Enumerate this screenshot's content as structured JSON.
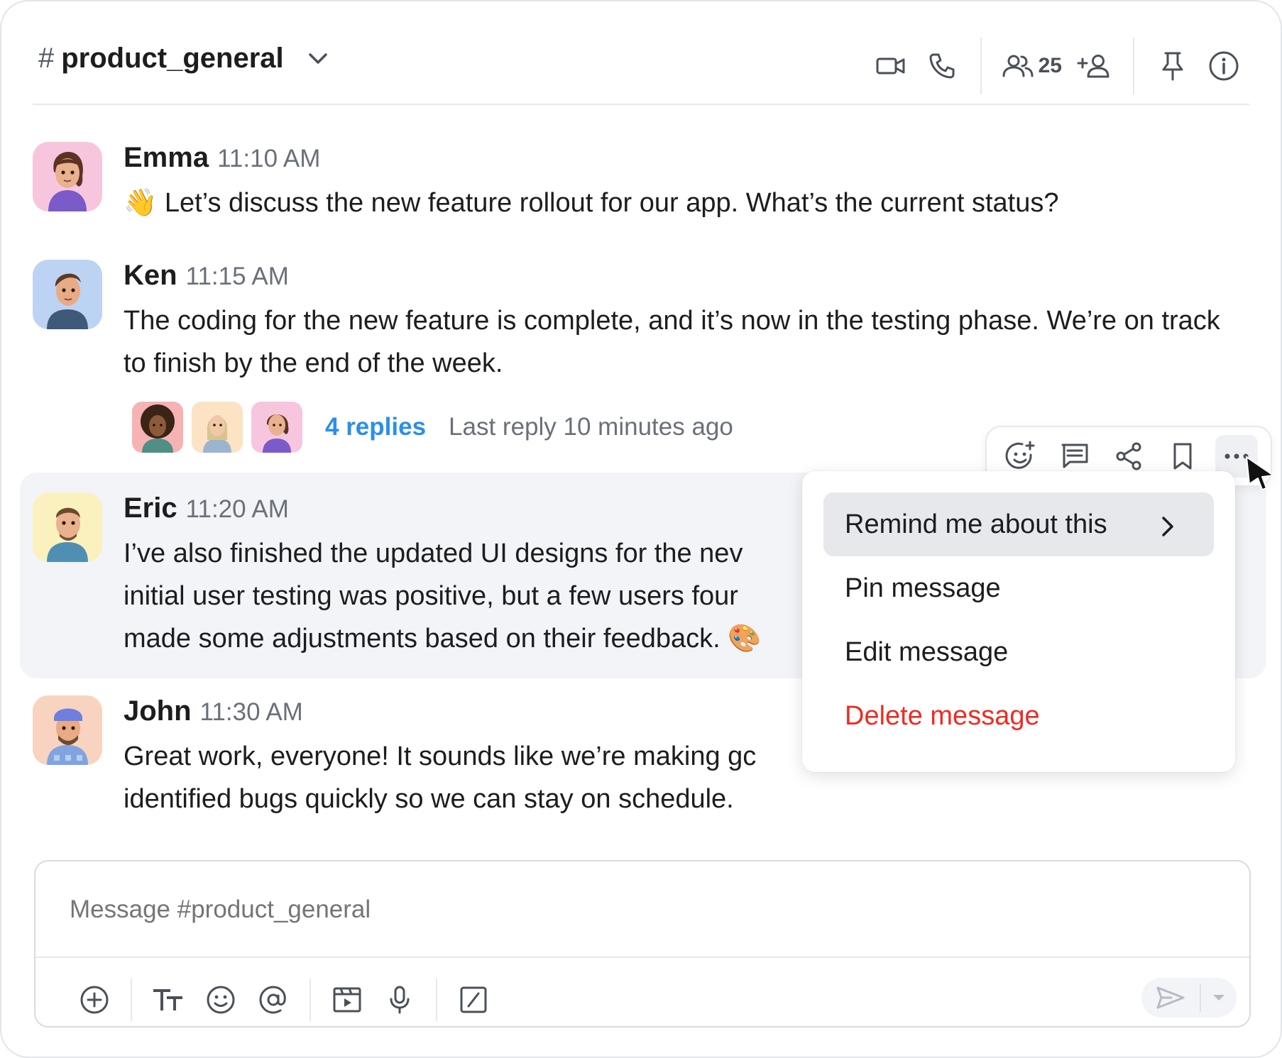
{
  "channel": {
    "hash": "#",
    "name": "product_general",
    "member_count": "25"
  },
  "messages": [
    {
      "author": "Emma",
      "time": "11:10 AM",
      "text": "👋 Let’s discuss the new feature rollout for our app. What’s the current status?"
    },
    {
      "author": "Ken",
      "time": "11:15 AM",
      "text": "The coding for the new feature is complete, and it’s now in the testing phase. We’re on track to finish by the end of the week."
    },
    {
      "author": "Eric",
      "time": "11:20 AM",
      "text": "I’ve also finished the updated UI designs for the nev initial user testing was positive, but a few users four made some adjustments based on their feedback. 🎨"
    },
    {
      "author": "John",
      "time": "11:30 AM",
      "text": "Great work, everyone! It sounds like we’re making gc identified bugs quickly so we can stay on schedule."
    }
  ],
  "thread": {
    "replies": "4 replies",
    "last_reply": "Last reply 10 minutes ago"
  },
  "context_menu": {
    "items": [
      {
        "label": "Remind me about this",
        "has_submenu": true
      },
      {
        "label": "Pin message"
      },
      {
        "label": "Edit message"
      },
      {
        "label": "Delete message",
        "danger": true
      }
    ]
  },
  "composer": {
    "placeholder": "Message #product_general"
  },
  "colors": {
    "accent": "#2a8fe8",
    "danger": "#ef2b22",
    "highlight": "#f2f4f7"
  }
}
